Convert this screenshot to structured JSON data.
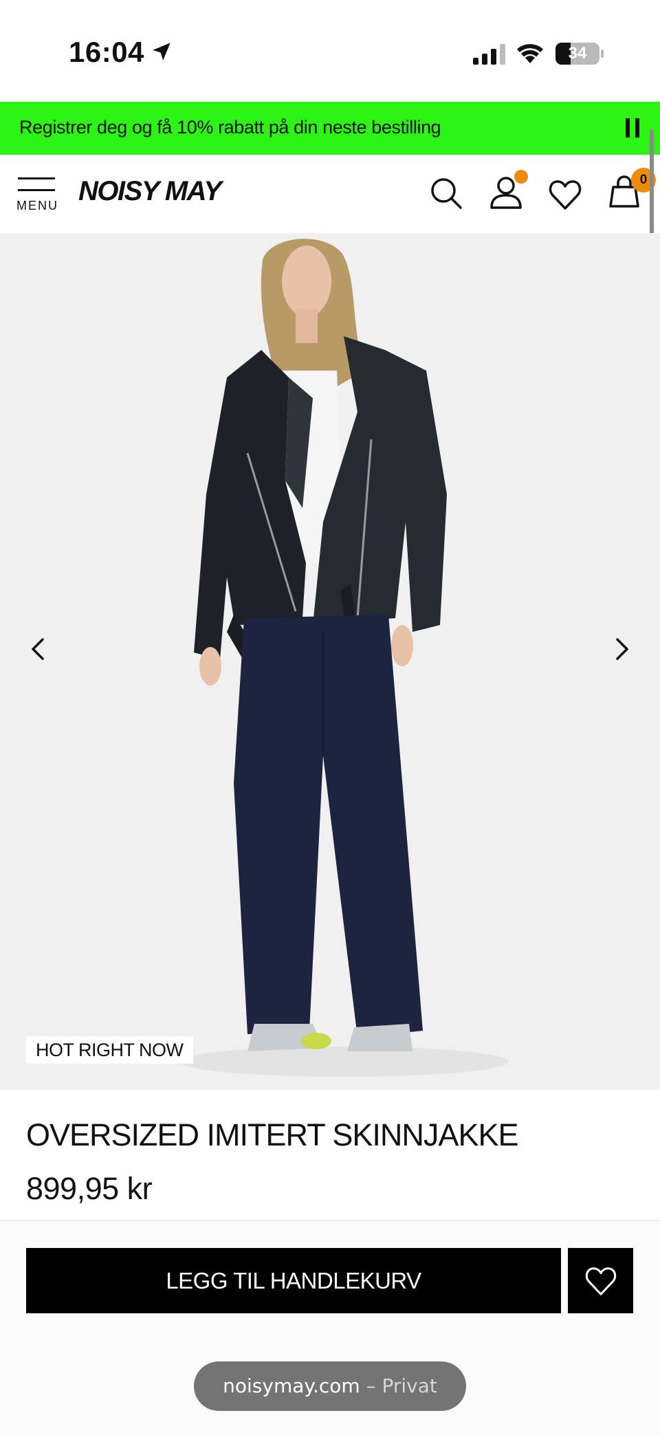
{
  "status_bar": {
    "time": "16:04",
    "battery": "34",
    "battery_level": 0.34,
    "icons": [
      "location-arrow-icon",
      "signal-icon",
      "wifi-icon",
      "battery-icon"
    ]
  },
  "promo": {
    "text": "Registrer deg og få 10% rabatt på din neste bestilling",
    "background": "#2cf516",
    "pause_icon": "pause-icon"
  },
  "header": {
    "menu_label": "MENU",
    "logo": "NOISY MAY",
    "icons": [
      "search-icon",
      "account-icon",
      "wishlist-icon",
      "cart-icon"
    ],
    "cart_count": "0",
    "accent": "#f08a0a"
  },
  "gallery": {
    "badge": "HOT RIGHT NOW",
    "prev_icon": "chevron-left-icon",
    "next_icon": "chevron-right-icon"
  },
  "product": {
    "title": "OVERSIZED IMITERT SKINNJAKKE",
    "price": "899,95 kr"
  },
  "actions": {
    "add_to_cart": "LEGG TIL HANDLEKURV",
    "wishlist_icon": "heart-icon"
  },
  "browser": {
    "domain": "noisymay.com",
    "mode": "– Privat"
  }
}
